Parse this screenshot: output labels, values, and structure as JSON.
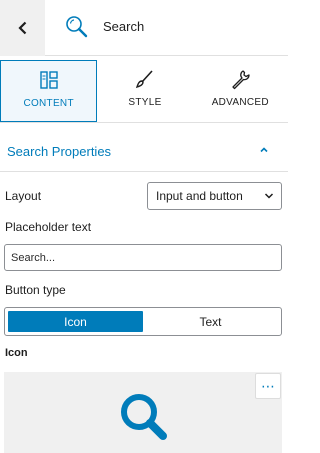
{
  "header": {
    "title": "Search",
    "back_icon": "chevron-left-icon",
    "block_icon": "search-icon"
  },
  "tabs": [
    {
      "label": "CONTENT",
      "icon": "layout-icon",
      "active": true
    },
    {
      "label": "STYLE",
      "icon": "brush-icon",
      "active": false
    },
    {
      "label": "ADVANCED",
      "icon": "wrench-icon",
      "active": false
    }
  ],
  "section": {
    "title": "Search Properties",
    "expanded": true
  },
  "fields": {
    "layout_label": "Layout",
    "layout_value": "Input and button",
    "placeholder_label": "Placeholder text",
    "placeholder_value": "Search...",
    "button_type_label": "Button type",
    "button_type_options": [
      "Icon",
      "Text"
    ],
    "button_type_selected": "Icon",
    "icon_label": "Icon",
    "icon_more": "⋯"
  },
  "colors": {
    "accent": "#007cba",
    "panel_gray": "#f0f0f0",
    "border": "#8c8f94"
  }
}
